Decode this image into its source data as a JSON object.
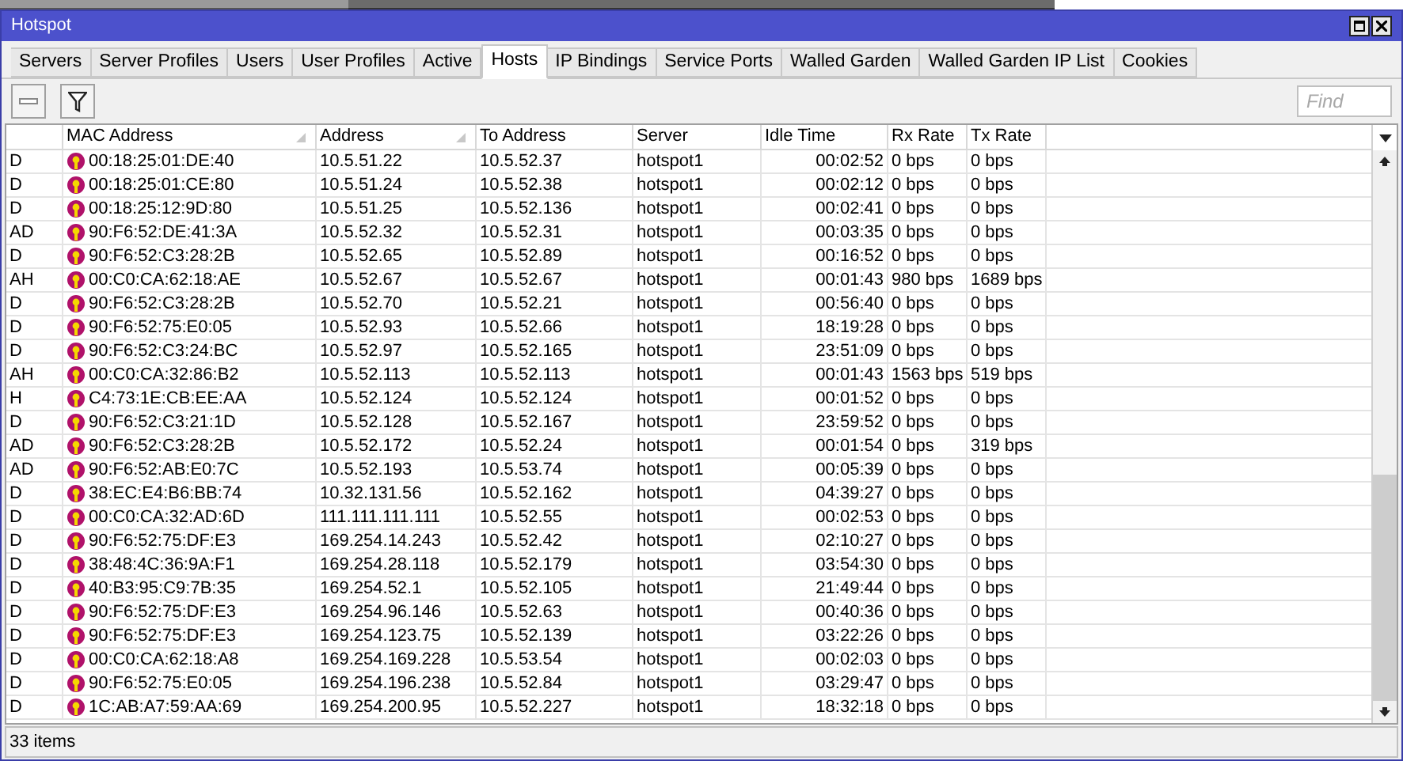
{
  "window": {
    "title": "Hotspot"
  },
  "tabs": [
    {
      "label": "Servers",
      "selected": false
    },
    {
      "label": "Server Profiles",
      "selected": false
    },
    {
      "label": "Users",
      "selected": false
    },
    {
      "label": "User Profiles",
      "selected": false
    },
    {
      "label": "Active",
      "selected": false
    },
    {
      "label": "Hosts",
      "selected": true
    },
    {
      "label": "IP Bindings",
      "selected": false
    },
    {
      "label": "Service Ports",
      "selected": false
    },
    {
      "label": "Walled Garden",
      "selected": false
    },
    {
      "label": "Walled Garden IP List",
      "selected": false
    },
    {
      "label": "Cookies",
      "selected": false
    }
  ],
  "search": {
    "placeholder": "Find"
  },
  "table": {
    "columns": [
      {
        "sorted": false
      },
      {
        "label": "MAC Address",
        "sorted": true
      },
      {
        "label": "Address",
        "sorted": true
      },
      {
        "label": "To Address",
        "sorted": false
      },
      {
        "label": "Server",
        "sorted": false
      },
      {
        "label": "Idle Time",
        "sorted": false
      },
      {
        "label": "Rx Rate",
        "sorted": false
      },
      {
        "label": "Tx Rate",
        "sorted": false
      }
    ],
    "rows": [
      [
        "D",
        "00:18:25:01:DE:40",
        "10.5.51.22",
        "10.5.52.37",
        "hotspot1",
        "00:02:52",
        "0 bps",
        "0 bps"
      ],
      [
        "D",
        "00:18:25:01:CE:80",
        "10.5.51.24",
        "10.5.52.38",
        "hotspot1",
        "00:02:12",
        "0 bps",
        "0 bps"
      ],
      [
        "D",
        "00:18:25:12:9D:80",
        "10.5.51.25",
        "10.5.52.136",
        "hotspot1",
        "00:02:41",
        "0 bps",
        "0 bps"
      ],
      [
        "AD",
        "90:F6:52:DE:41:3A",
        "10.5.52.32",
        "10.5.52.31",
        "hotspot1",
        "00:03:35",
        "0 bps",
        "0 bps"
      ],
      [
        "D",
        "90:F6:52:C3:28:2B",
        "10.5.52.65",
        "10.5.52.89",
        "hotspot1",
        "00:16:52",
        "0 bps",
        "0 bps"
      ],
      [
        "AH",
        "00:C0:CA:62:18:AE",
        "10.5.52.67",
        "10.5.52.67",
        "hotspot1",
        "00:01:43",
        "980 bps",
        "1689 bps"
      ],
      [
        "D",
        "90:F6:52:C3:28:2B",
        "10.5.52.70",
        "10.5.52.21",
        "hotspot1",
        "00:56:40",
        "0 bps",
        "0 bps"
      ],
      [
        "D",
        "90:F6:52:75:E0:05",
        "10.5.52.93",
        "10.5.52.66",
        "hotspot1",
        "18:19:28",
        "0 bps",
        "0 bps"
      ],
      [
        "D",
        "90:F6:52:C3:24:BC",
        "10.5.52.97",
        "10.5.52.165",
        "hotspot1",
        "23:51:09",
        "0 bps",
        "0 bps"
      ],
      [
        "AH",
        "00:C0:CA:32:86:B2",
        "10.5.52.113",
        "10.5.52.113",
        "hotspot1",
        "00:01:43",
        "1563 bps",
        "519 bps"
      ],
      [
        "H",
        "C4:73:1E:CB:EE:AA",
        "10.5.52.124",
        "10.5.52.124",
        "hotspot1",
        "00:01:52",
        "0 bps",
        "0 bps"
      ],
      [
        "D",
        "90:F6:52:C3:21:1D",
        "10.5.52.128",
        "10.5.52.167",
        "hotspot1",
        "23:59:52",
        "0 bps",
        "0 bps"
      ],
      [
        "AD",
        "90:F6:52:C3:28:2B",
        "10.5.52.172",
        "10.5.52.24",
        "hotspot1",
        "00:01:54",
        "0 bps",
        "319 bps"
      ],
      [
        "AD",
        "90:F6:52:AB:E0:7C",
        "10.5.52.193",
        "10.5.53.74",
        "hotspot1",
        "00:05:39",
        "0 bps",
        "0 bps"
      ],
      [
        "D",
        "38:EC:E4:B6:BB:74",
        "10.32.131.56",
        "10.5.52.162",
        "hotspot1",
        "04:39:27",
        "0 bps",
        "0 bps"
      ],
      [
        "D",
        "00:C0:CA:32:AD:6D",
        "111.111.111.111",
        "10.5.52.55",
        "hotspot1",
        "00:02:53",
        "0 bps",
        "0 bps"
      ],
      [
        "D",
        "90:F6:52:75:DF:E3",
        "169.254.14.243",
        "10.5.52.42",
        "hotspot1",
        "02:10:27",
        "0 bps",
        "0 bps"
      ],
      [
        "D",
        "38:48:4C:36:9A:F1",
        "169.254.28.118",
        "10.5.52.179",
        "hotspot1",
        "03:54:30",
        "0 bps",
        "0 bps"
      ],
      [
        "D",
        "40:B3:95:C9:7B:35",
        "169.254.52.1",
        "10.5.52.105",
        "hotspot1",
        "21:49:44",
        "0 bps",
        "0 bps"
      ],
      [
        "D",
        "90:F6:52:75:DF:E3",
        "169.254.96.146",
        "10.5.52.63",
        "hotspot1",
        "00:40:36",
        "0 bps",
        "0 bps"
      ],
      [
        "D",
        "90:F6:52:75:DF:E3",
        "169.254.123.75",
        "10.5.52.139",
        "hotspot1",
        "03:22:26",
        "0 bps",
        "0 bps"
      ],
      [
        "D",
        "00:C0:CA:62:18:A8",
        "169.254.169.228",
        "10.5.53.54",
        "hotspot1",
        "00:02:03",
        "0 bps",
        "0 bps"
      ],
      [
        "D",
        "90:F6:52:75:E0:05",
        "169.254.196.238",
        "10.5.52.84",
        "hotspot1",
        "03:29:47",
        "0 bps",
        "0 bps"
      ],
      [
        "D",
        "1C:AB:A7:59:AA:69",
        "169.254.200.95",
        "10.5.52.227",
        "hotspot1",
        "18:32:18",
        "0 bps",
        "0 bps"
      ]
    ]
  },
  "status_bar": "33 items"
}
